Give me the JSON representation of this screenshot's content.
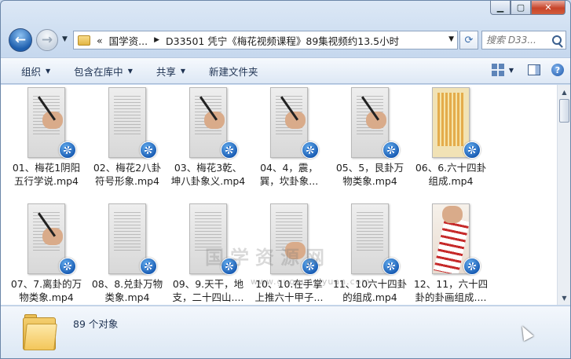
{
  "window": {
    "minimize_glyph": "▁",
    "maximize_glyph": "▢",
    "close_glyph": "✕"
  },
  "nav": {
    "back_glyph": "←",
    "forward_glyph": "→",
    "history_glyph": "▼"
  },
  "address": {
    "overflow": "«",
    "segments": [
      "国学资...",
      "D33501 凭宁《梅花视频课程》89集视频约13.5小时"
    ],
    "separator": "▶",
    "dropdown_glyph": "▼",
    "refresh_glyph": "⟳"
  },
  "search": {
    "placeholder": "搜索 D33..."
  },
  "toolbar": {
    "organize": "组织",
    "include_in_library": "包含在库中",
    "share": "共享",
    "new_folder": "新建文件夹",
    "caret": "▼",
    "help_glyph": "?"
  },
  "files": [
    {
      "line1": "01、梅花1阴阳",
      "line2": "五行学说.mp4",
      "thumb": "book-pen"
    },
    {
      "line1": "02、梅花2八卦",
      "line2": "符号形象.mp4",
      "thumb": "book"
    },
    {
      "line1": "03、梅花3乾、",
      "line2": "坤八卦象义.mp4",
      "thumb": "book-pen"
    },
    {
      "line1": "04、4，震，",
      "line2": "巽，坎卦象...",
      "thumb": "book-pen"
    },
    {
      "line1": "05、5，艮卦万",
      "line2": "物类象.mp4",
      "thumb": "book-pen"
    },
    {
      "line1": "06、6.六十四卦",
      "line2": "组成.mp4",
      "thumb": "grid"
    },
    {
      "line1": "07、7.离卦的万",
      "line2": "物类象.mp4",
      "thumb": "book-pen"
    },
    {
      "line1": "08、8.兑卦万物",
      "line2": "类象.mp4",
      "thumb": "book"
    },
    {
      "line1": "09、9.天干，地",
      "line2": "支，二十四山....",
      "thumb": "book"
    },
    {
      "line1": "10、10.在手掌",
      "line2": "上推六十甲子...",
      "thumb": "book-hand"
    },
    {
      "line1": "11、10六十四卦",
      "line2": "的组成.mp4",
      "thumb": "book"
    },
    {
      "line1": "12、11，六十四",
      "line2": "卦的卦画组成....",
      "thumb": "stripe"
    }
  ],
  "watermark": {
    "text": "国学资源网",
    "url": "www.guoxueziyuan.com"
  },
  "scrollbar": {
    "up_glyph": "▲",
    "down_glyph": "▼"
  },
  "status": {
    "count": "89 个对象"
  }
}
